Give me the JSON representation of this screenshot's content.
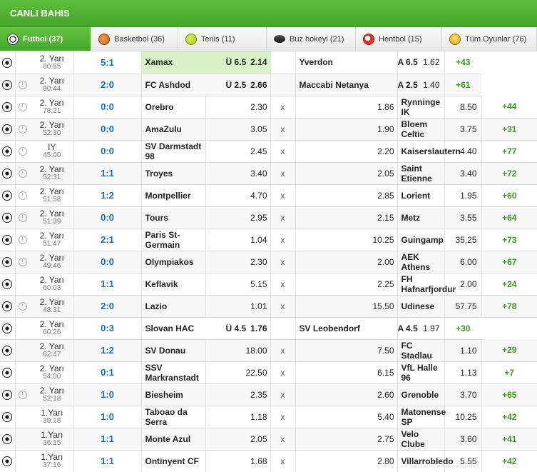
{
  "title": "CANLI BAHİS",
  "tabs": [
    {
      "label": "Futbol (37)",
      "icon": "football-icon",
      "active": true
    },
    {
      "label": "Basketbol (36)",
      "icon": "basketball-icon",
      "active": false
    },
    {
      "label": "Tenis (11)",
      "icon": "tennis-icon",
      "active": false
    },
    {
      "label": "Buz hokeyi (21)",
      "icon": "hockey-puck-icon",
      "active": false
    },
    {
      "label": "Hentbol (15)",
      "icon": "handball-icon",
      "active": false
    },
    {
      "label": "Tüm Oyunlar (76)",
      "icon": "trophy-icon",
      "active": false
    }
  ],
  "matches": [
    {
      "period": "2. Yarı",
      "minute": "80:55",
      "score": "5:1",
      "home": "Xamax",
      "home_ou": "Ü 6.5",
      "home_odd": "2.14",
      "draw": "",
      "draw_odd": "",
      "away": "Yverdon",
      "away_ou": "A 6.5",
      "away_odd": "1.62",
      "more": "+43",
      "clock": false,
      "ou": true,
      "highlight": true
    },
    {
      "period": "2. Yarı",
      "minute": "80:44",
      "score": "2:0",
      "home": "FC Ashdod",
      "home_ou": "Ü 2.5",
      "home_odd": "2.66",
      "draw": "",
      "draw_odd": "",
      "away": "Maccabi Netanya",
      "away_ou": "A 2.5",
      "away_odd": "1.40",
      "more": "+61",
      "clock": true,
      "ou": true
    },
    {
      "period": "2. Yarı",
      "minute": "78:21",
      "score": "0:0",
      "home": "Orebro",
      "home_odd": "2.30",
      "draw": "x",
      "draw_odd": "1.86",
      "away": "Rynninge IK",
      "away_odd": "8.50",
      "more": "+44",
      "clock": true
    },
    {
      "period": "2. Yarı",
      "minute": "52:30",
      "score": "0:0",
      "home": "AmaZulu",
      "home_odd": "3.05",
      "draw": "x",
      "draw_odd": "1.90",
      "away": "Bloem Celtic",
      "away_odd": "3.75",
      "more": "+31",
      "clock": true
    },
    {
      "period": "IY",
      "minute": "45:00",
      "score": "0:0",
      "home": "SV Darmstadt 98",
      "home_odd": "2.45",
      "draw": "x",
      "draw_odd": "2.20",
      "away": "Kaiserslautern",
      "away_odd": "4.40",
      "more": "+77",
      "clock": true
    },
    {
      "period": "2. Yarı",
      "minute": "52:31",
      "score": "1:1",
      "home": "Troyes",
      "home_odd": "3.40",
      "draw": "x",
      "draw_odd": "2.05",
      "away": "Saint Etienne",
      "away_odd": "3.40",
      "more": "+72",
      "clock": true
    },
    {
      "period": "2. Yarı",
      "minute": "51:58",
      "score": "1:2",
      "home": "Montpellier",
      "home_odd": "4.70",
      "draw": "x",
      "draw_odd": "2.85",
      "away": "Lorient",
      "away_odd": "1.95",
      "more": "+60",
      "clock": true
    },
    {
      "period": "2. Yarı",
      "minute": "51:39",
      "score": "0:0",
      "home": "Tours",
      "home_odd": "2.95",
      "draw": "x",
      "draw_odd": "2.15",
      "away": "Metz",
      "away_odd": "3.55",
      "more": "+64",
      "clock": true
    },
    {
      "period": "2. Yarı",
      "minute": "51:47",
      "score": "2:1",
      "home": "Paris St-Germain",
      "home_odd": "1.04",
      "draw": "x",
      "draw_odd": "10.25",
      "away": "Guingamp",
      "away_odd": "35.25",
      "more": "+73",
      "clock": true
    },
    {
      "period": "2. Yarı",
      "minute": "49:46",
      "score": "0:0",
      "home": "Olympiakos",
      "home_odd": "2.30",
      "draw": "x",
      "draw_odd": "2.00",
      "away": "AEK Athens",
      "away_odd": "6.00",
      "more": "+67",
      "clock": true
    },
    {
      "period": "2. Yarı",
      "minute": "60:03",
      "score": "1:1",
      "home": "Keflavik",
      "home_odd": "5.15",
      "draw": "x",
      "draw_odd": "2.25",
      "away": "FH Hafnarfjordur",
      "away_odd": "2.00",
      "more": "+24",
      "clock": false
    },
    {
      "period": "2. Yarı",
      "minute": "48:31",
      "score": "2:0",
      "home": "Lazio",
      "home_odd": "1.01",
      "draw": "x",
      "draw_odd": "15.50",
      "away": "Udinese",
      "away_odd": "57.75",
      "more": "+78",
      "clock": true
    },
    {
      "period": "2. Yarı",
      "minute": "60:26",
      "score": "0:3",
      "home": "Slovan HAC",
      "home_ou": "Ü 4.5",
      "home_odd": "1.76",
      "draw": "",
      "draw_odd": "",
      "away": "SV Leobendorf",
      "away_ou": "A 4.5",
      "away_odd": "1.97",
      "more": "+30",
      "clock": false,
      "ou": true
    },
    {
      "period": "2. Yarı",
      "minute": "62:47",
      "score": "1:2",
      "home": "SV Donau",
      "home_odd": "18.00",
      "draw": "x",
      "draw_odd": "7.50",
      "away": "FC Stadlau",
      "away_odd": "1.10",
      "more": "+29",
      "clock": false
    },
    {
      "period": "2. Yarı",
      "minute": "54:00",
      "score": "0:1",
      "home": "SSV Markranstadt",
      "home_odd": "22.50",
      "draw": "x",
      "draw_odd": "6.15",
      "away": "VfL Halle 96",
      "away_odd": "1.13",
      "more": "+7",
      "clock": false
    },
    {
      "period": "2. Yarı",
      "minute": "52:18",
      "score": "1:0",
      "home": "Biesheim",
      "home_odd": "2.35",
      "draw": "x",
      "draw_odd": "2.60",
      "away": "Grenoble",
      "away_odd": "3.70",
      "more": "+65",
      "clock": true
    },
    {
      "period": "1.Yarı",
      "minute": "39:18",
      "score": "1:0",
      "home": "Taboao da Serra",
      "home_odd": "1.18",
      "draw": "x",
      "draw_odd": "5.40",
      "away": "Matonense SP",
      "away_odd": "10.25",
      "more": "+42",
      "clock": false
    },
    {
      "period": "1.Yarı",
      "minute": "36:15",
      "score": "1:1",
      "home": "Monte Azul",
      "home_odd": "2.05",
      "draw": "x",
      "draw_odd": "2.75",
      "away": "Velo Clube",
      "away_odd": "3.60",
      "more": "+41",
      "clock": false
    },
    {
      "period": "1.Yarı",
      "minute": "37:16",
      "score": "1:1",
      "home": "Ontinyent CF",
      "home_odd": "1.68",
      "draw": "x",
      "draw_odd": "2.80",
      "away": "Villarrobledo",
      "away_odd": "5.55",
      "more": "+42",
      "clock": false
    }
  ],
  "colors": {
    "header_green": "#4fb12f",
    "score_blue": "#1b6fb5",
    "more_green": "#3a9a1f",
    "highlight": "#d9f1c7"
  }
}
